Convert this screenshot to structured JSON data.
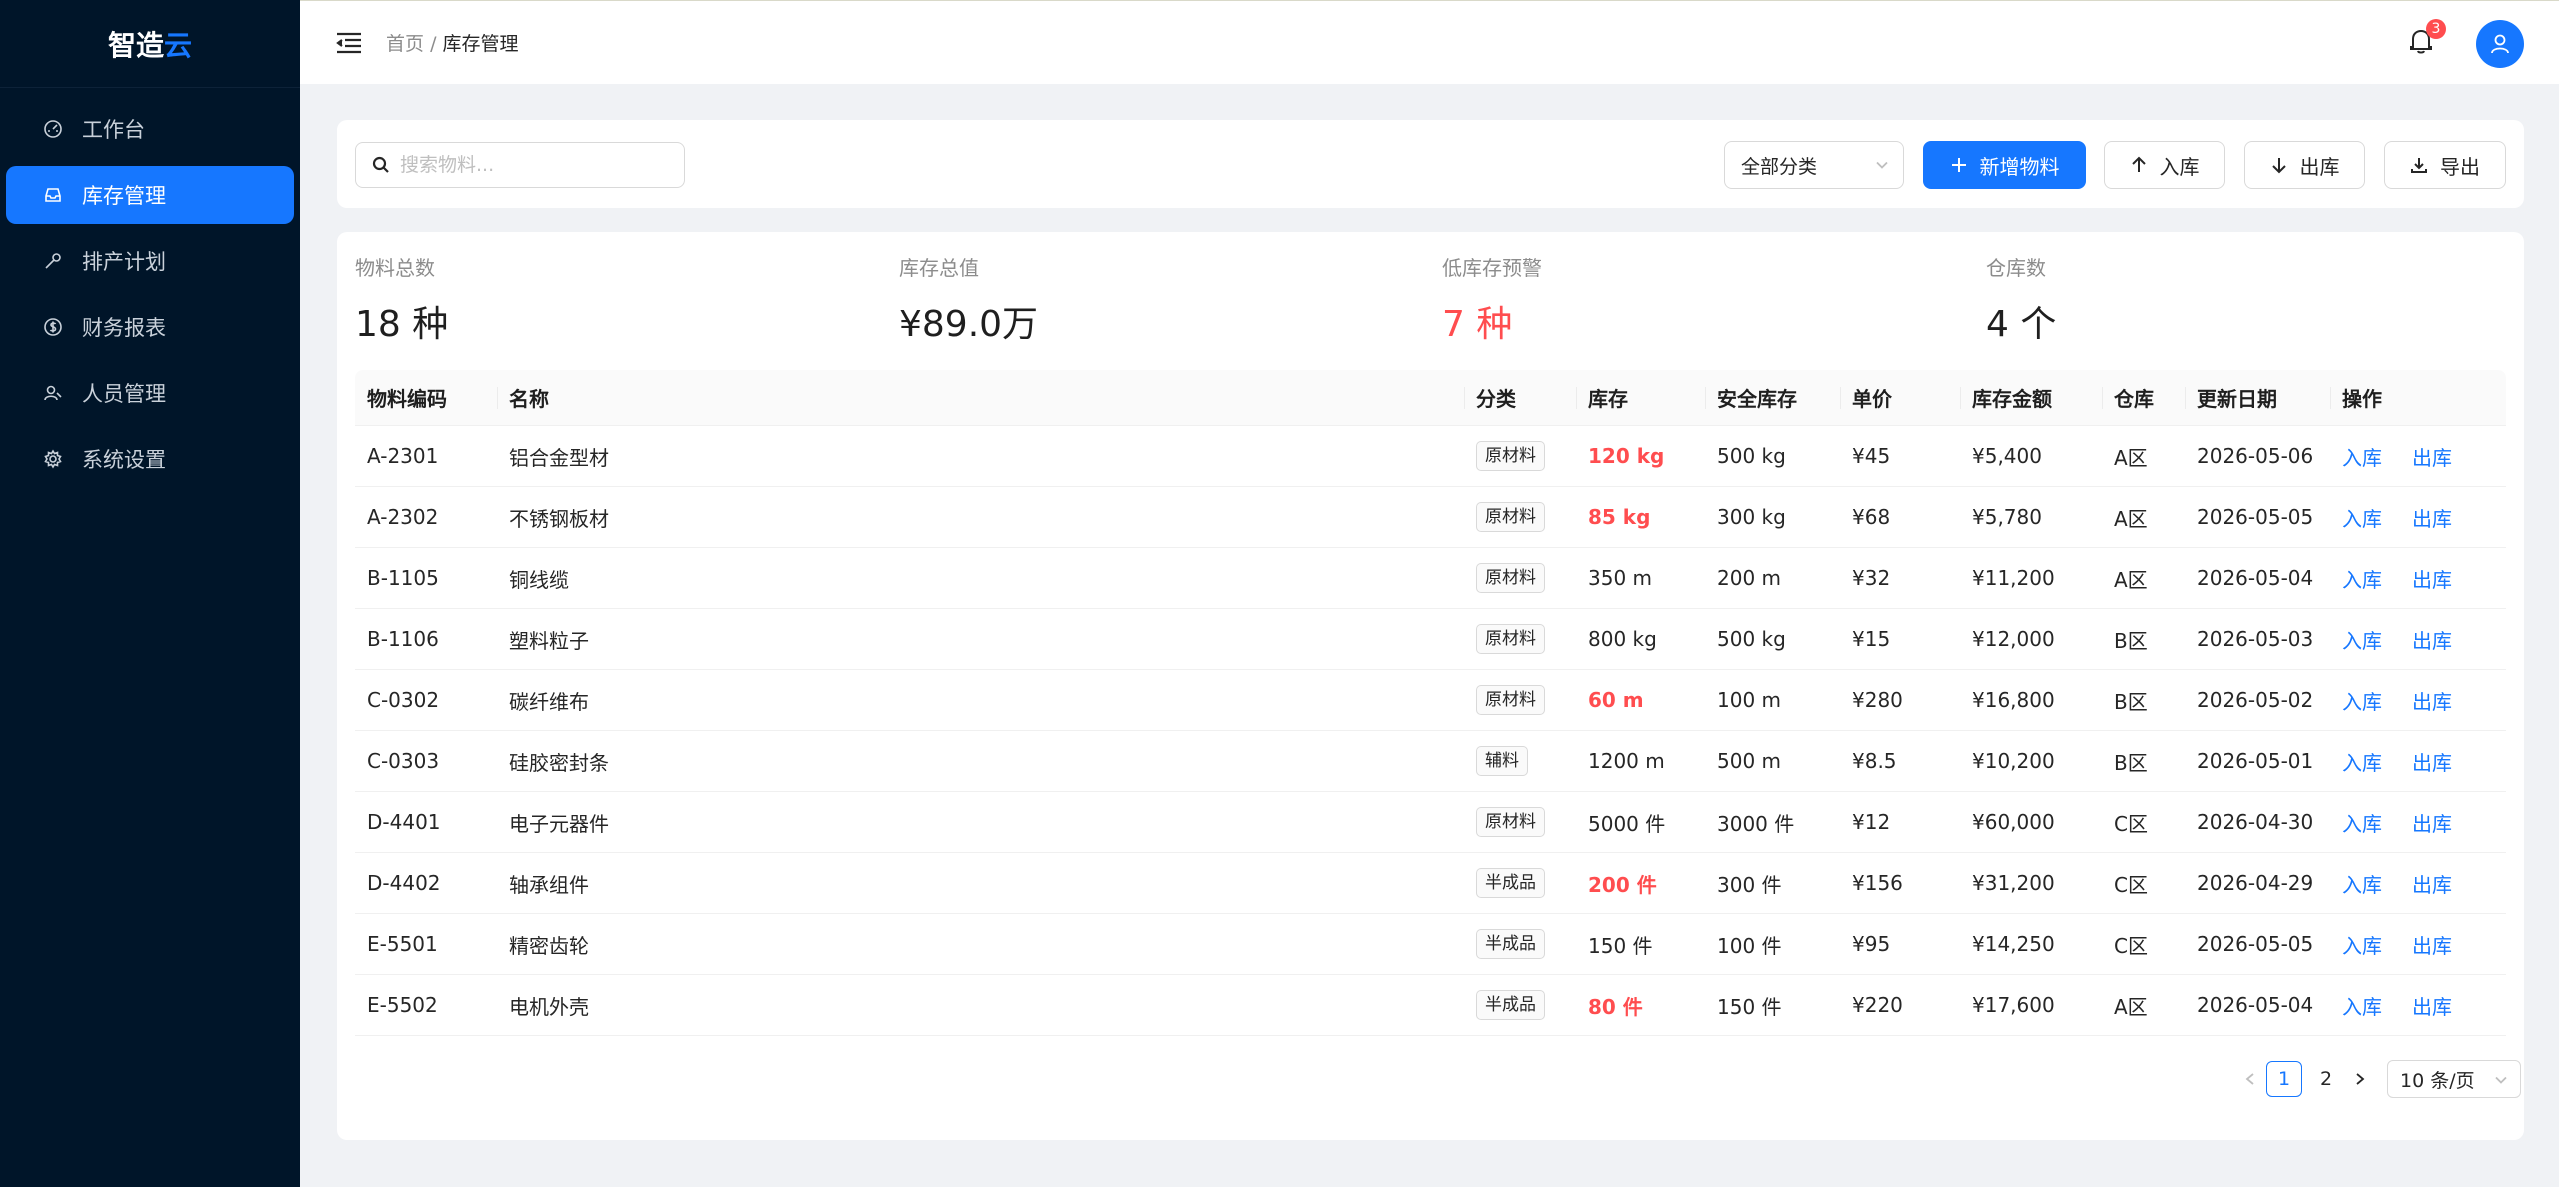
{
  "app": {
    "logo_main": "智造",
    "logo_accent": "云"
  },
  "sidebar": {
    "items": [
      {
        "label": "工作台",
        "icon": "dashboard-icon"
      },
      {
        "label": "库存管理",
        "icon": "inbox-icon",
        "active": true
      },
      {
        "label": "排产计划",
        "icon": "tool-icon"
      },
      {
        "label": "财务报表",
        "icon": "dollar-icon"
      },
      {
        "label": "人员管理",
        "icon": "user-icon"
      },
      {
        "label": "系统设置",
        "icon": "gear-icon"
      }
    ]
  },
  "header": {
    "breadcrumb_home": "首页",
    "breadcrumb_sep": "/",
    "breadcrumb_current": "库存管理",
    "notification_count": "3"
  },
  "toolbar": {
    "search_placeholder": "搜索物料...",
    "category_value": "全部分类",
    "add_label": "新增物料",
    "in_label": "入库",
    "out_label": "出库",
    "export_label": "导出"
  },
  "stats": [
    {
      "title": "物料总数",
      "value": "18 种"
    },
    {
      "title": "库存总值",
      "value": "¥89.0万"
    },
    {
      "title": "低库存预警",
      "value": "7 种"
    },
    {
      "title": "仓库数",
      "value": "4 个"
    }
  ],
  "table": {
    "headers": [
      "物料编码",
      "名称",
      "分类",
      "库存",
      "安全库存",
      "单价",
      "库存金额",
      "仓库",
      "更新日期",
      "操作"
    ],
    "action_in": "入库",
    "action_out": "出库",
    "rows": [
      {
        "code": "A-2301",
        "name": "铝合金型材",
        "category": "原材料",
        "stock": "120 kg",
        "safety": "500 kg",
        "price": "¥45",
        "amount": "¥5,400",
        "warehouse": "A区",
        "date": "2026-05-06"
      },
      {
        "code": "A-2302",
        "name": "不锈钢板材",
        "category": "原材料",
        "stock": "85 kg",
        "safety": "300 kg",
        "price": "¥68",
        "amount": "¥5,780",
        "warehouse": "A区",
        "date": "2026-05-05"
      },
      {
        "code": "B-1105",
        "name": "铜线缆",
        "category": "原材料",
        "stock": "350 m",
        "safety": "200 m",
        "price": "¥32",
        "amount": "¥11,200",
        "warehouse": "A区",
        "date": "2026-05-04"
      },
      {
        "code": "B-1106",
        "name": "塑料粒子",
        "category": "原材料",
        "stock": "800 kg",
        "safety": "500 kg",
        "price": "¥15",
        "amount": "¥12,000",
        "warehouse": "B区",
        "date": "2026-05-03"
      },
      {
        "code": "C-0302",
        "name": "碳纤维布",
        "category": "原材料",
        "stock": "60 m",
        "safety": "100 m",
        "price": "¥280",
        "amount": "¥16,800",
        "warehouse": "B区",
        "date": "2026-05-02"
      },
      {
        "code": "C-0303",
        "name": "硅胶密封条",
        "category": "辅料",
        "stock": "1200 m",
        "safety": "500 m",
        "price": "¥8.5",
        "amount": "¥10,200",
        "warehouse": "B区",
        "date": "2026-05-01"
      },
      {
        "code": "D-4401",
        "name": "电子元器件",
        "category": "原材料",
        "stock": "5000 件",
        "safety": "3000 件",
        "price": "¥12",
        "amount": "¥60,000",
        "warehouse": "C区",
        "date": "2026-04-30"
      },
      {
        "code": "D-4402",
        "name": "轴承组件",
        "category": "半成品",
        "stock": "200 件",
        "safety": "300 件",
        "price": "¥156",
        "amount": "¥31,200",
        "warehouse": "C区",
        "date": "2026-04-29"
      },
      {
        "code": "E-5501",
        "name": "精密齿轮",
        "category": "半成品",
        "stock": "150 件",
        "safety": "100 件",
        "price": "¥95",
        "amount": "¥14,250",
        "warehouse": "C区",
        "date": "2026-05-05"
      },
      {
        "code": "E-5502",
        "name": "电机外壳",
        "category": "半成品",
        "stock": "80 件",
        "safety": "150 件",
        "price": "¥220",
        "amount": "¥17,600",
        "warehouse": "A区",
        "date": "2026-05-04"
      }
    ]
  },
  "pagination": {
    "pages": [
      "1",
      "2"
    ],
    "current": "1",
    "page_size": "10 条/页"
  },
  "colors": {
    "primary": "#1677ff",
    "sidebar_bg": "#001529",
    "danger": "#ff4d4f",
    "page_bg": "#f0f2f5"
  }
}
